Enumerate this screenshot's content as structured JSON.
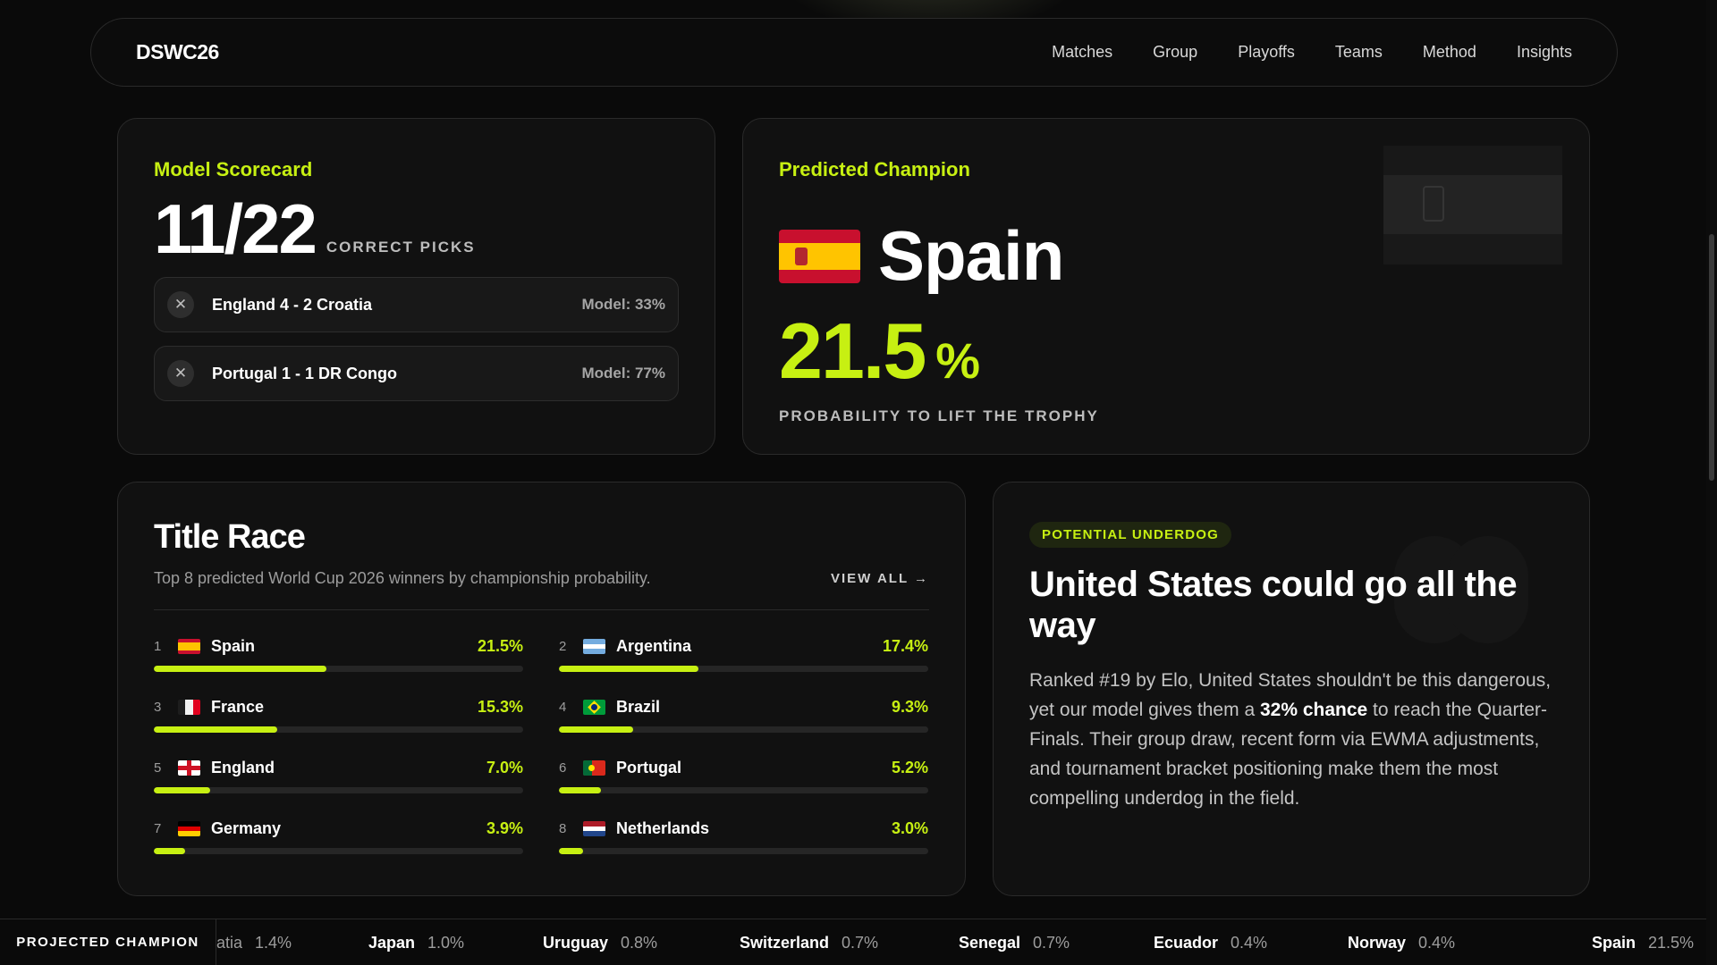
{
  "nav": {
    "brand": "DSWC26",
    "links": [
      "Matches",
      "Group",
      "Playoffs",
      "Teams",
      "Method",
      "Insights"
    ]
  },
  "scorecard": {
    "title": "Model Scorecard",
    "score": "11/22",
    "score_caption": "CORRECT PICKS",
    "picks": [
      {
        "match": "England 4 - 2 Croatia",
        "model": "Model: 33%"
      },
      {
        "match": "Portugal 1 - 1 DR Congo",
        "model": "Model: 77%"
      }
    ]
  },
  "champion": {
    "title": "Predicted Champion",
    "team": "Spain",
    "probability": "21.5",
    "percent_sign": "%",
    "caption": "PROBABILITY TO LIFT THE TROPHY"
  },
  "race": {
    "title": "Title Race",
    "subtitle": "Top 8 predicted World Cup 2026 winners by championship probability.",
    "view_all": "VIEW ALL →",
    "teams": [
      {
        "rank": "1",
        "name": "Spain",
        "pct": "21.5%",
        "value": 21.5,
        "flag": "spain-flag-icon"
      },
      {
        "rank": "2",
        "name": "Argentina",
        "pct": "17.4%",
        "value": 17.4,
        "flag": "argentina-flag-icon"
      },
      {
        "rank": "3",
        "name": "France",
        "pct": "15.3%",
        "value": 15.3,
        "flag": "france-flag-icon"
      },
      {
        "rank": "4",
        "name": "Brazil",
        "pct": "9.3%",
        "value": 9.3,
        "flag": "brazil-flag-icon"
      },
      {
        "rank": "5",
        "name": "England",
        "pct": "7.0%",
        "value": 7.0,
        "flag": "england-flag-icon"
      },
      {
        "rank": "6",
        "name": "Portugal",
        "pct": "5.2%",
        "value": 5.2,
        "flag": "portugal-flag-icon"
      },
      {
        "rank": "7",
        "name": "Germany",
        "pct": "3.9%",
        "value": 3.9,
        "flag": "germany-flag-icon"
      },
      {
        "rank": "8",
        "name": "Netherlands",
        "pct": "3.0%",
        "value": 3.0,
        "flag": "netherlands-flag-icon"
      }
    ]
  },
  "underdog": {
    "badge": "POTENTIAL UNDERDOG",
    "title": "United States could go all the way",
    "body_1": "Ranked #19 by Elo, United States shouldn't be this dangerous, yet our model gives them a ",
    "body_bold": "32% chance",
    "body_2": " to reach the Quarter-Finals. Their group draw, recent form via EWMA adjustments, and tournament bracket positioning make them the most compelling underdog in the field."
  },
  "ticker": {
    "label": "PROJECTED CHAMPION",
    "items": [
      {
        "name": "atia",
        "pct": "1.4%"
      },
      {
        "name": "Japan",
        "pct": "1.0%"
      },
      {
        "name": "Uruguay",
        "pct": "0.8%"
      },
      {
        "name": "Switzerland",
        "pct": "0.7%"
      },
      {
        "name": "Senegal",
        "pct": "0.7%"
      },
      {
        "name": "Ecuador",
        "pct": "0.4%"
      },
      {
        "name": "Norway",
        "pct": "0.4%"
      },
      {
        "name": "Spain",
        "pct": "21.5%"
      }
    ]
  },
  "colors": {
    "accent": "#c7f012",
    "background": "#0a0a0a",
    "card": "#111111"
  }
}
